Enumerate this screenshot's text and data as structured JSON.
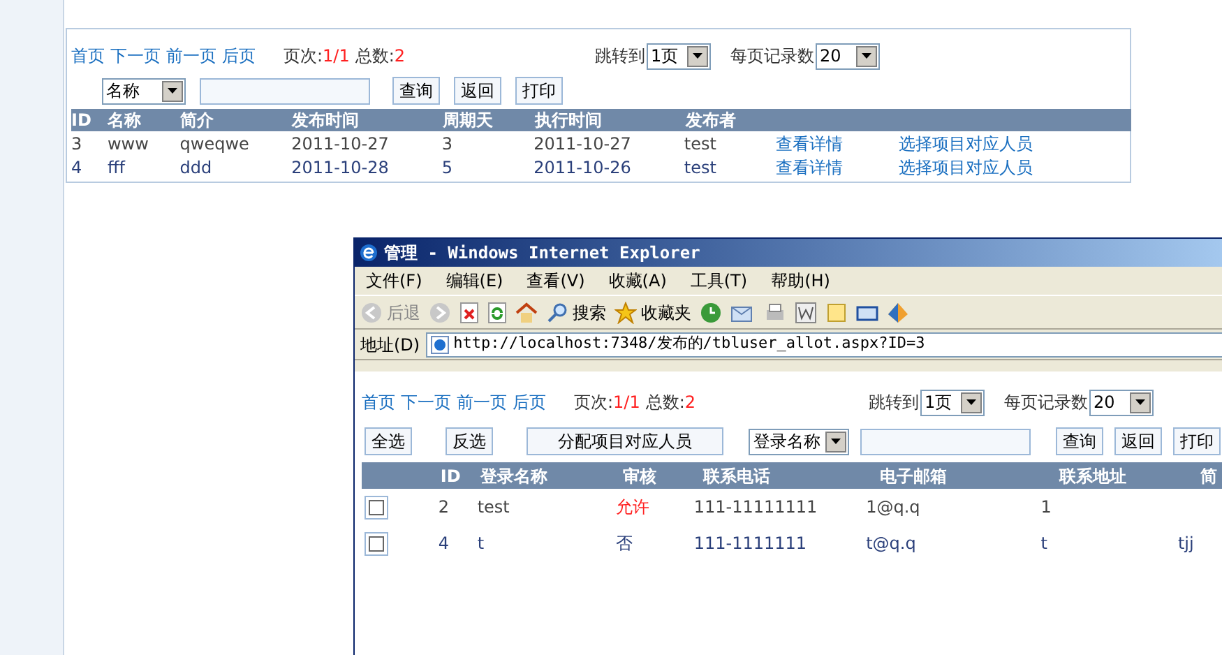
{
  "main": {
    "pager": {
      "links": [
        "首页",
        "下一页",
        "前一页",
        "后页"
      ],
      "page_label": "页次:",
      "page_value": "1/1",
      "total_label": "总数:",
      "total_value": "2",
      "jump_label": "跳转到",
      "jump_value": "1页",
      "per_page_label": "每页记录数",
      "per_page_value": "20"
    },
    "search": {
      "field_select": "名称",
      "buttons": [
        "查询",
        "返回",
        "打印"
      ]
    },
    "table": {
      "columns": [
        "ID",
        "名称",
        "简介",
        "发布时间",
        "周期天",
        "执行时间",
        "发布者"
      ],
      "rows": [
        {
          "cells": [
            "3",
            "www",
            "qweqwe",
            "2011-10-27",
            "3",
            "2011-10-27",
            "test"
          ],
          "links": [
            "查看详情",
            "选择项目对应人员"
          ]
        },
        {
          "cells": [
            "4",
            "fff",
            "ddd",
            "2011-10-28",
            "5",
            "2011-10-26",
            "test"
          ],
          "links": [
            "查看详情",
            "选择项目对应人员"
          ]
        }
      ]
    }
  },
  "ie_window": {
    "title": "管理 - Windows Internet Explorer",
    "menu": [
      "文件(F)",
      "编辑(E)",
      "查看(V)",
      "收藏(A)",
      "工具(T)",
      "帮助(H)"
    ],
    "toolbar": {
      "back": "后退",
      "search": "搜索",
      "favorites": "收藏夹"
    },
    "address_label": "地址(D)",
    "url": "http://localhost:7348/发布的/tbluser_allot.aspx?ID=3",
    "page": {
      "pager": {
        "links": [
          "首页",
          "下一页",
          "前一页",
          "后页"
        ],
        "page_label": "页次:",
        "page_value": "1/1",
        "total_label": "总数:",
        "total_value": "2",
        "jump_label": "跳转到",
        "jump_value": "1页",
        "per_page_label": "每页记录数",
        "per_page_value": "20"
      },
      "actions": [
        "全选",
        "反选",
        "分配项目对应人员"
      ],
      "search": {
        "field_select": "登录名称",
        "buttons": [
          "查询",
          "返回",
          "打印"
        ]
      },
      "table": {
        "columns": [
          "ID",
          "登录名称",
          "审核",
          "联系电话",
          "电子邮箱",
          "联系地址",
          "简"
        ],
        "rows": [
          {
            "checked": false,
            "id": "2",
            "login": "test",
            "approval": "允许",
            "approved": true,
            "phone": "111-11111111",
            "email": "1@q.q",
            "address": "1"
          },
          {
            "checked": false,
            "id": "4",
            "login": "t",
            "approval": "否",
            "approved": false,
            "phone": "111-1111111",
            "email": "t@q.q",
            "address": "t",
            "column_7": "tjj"
          }
        ]
      }
    }
  }
}
